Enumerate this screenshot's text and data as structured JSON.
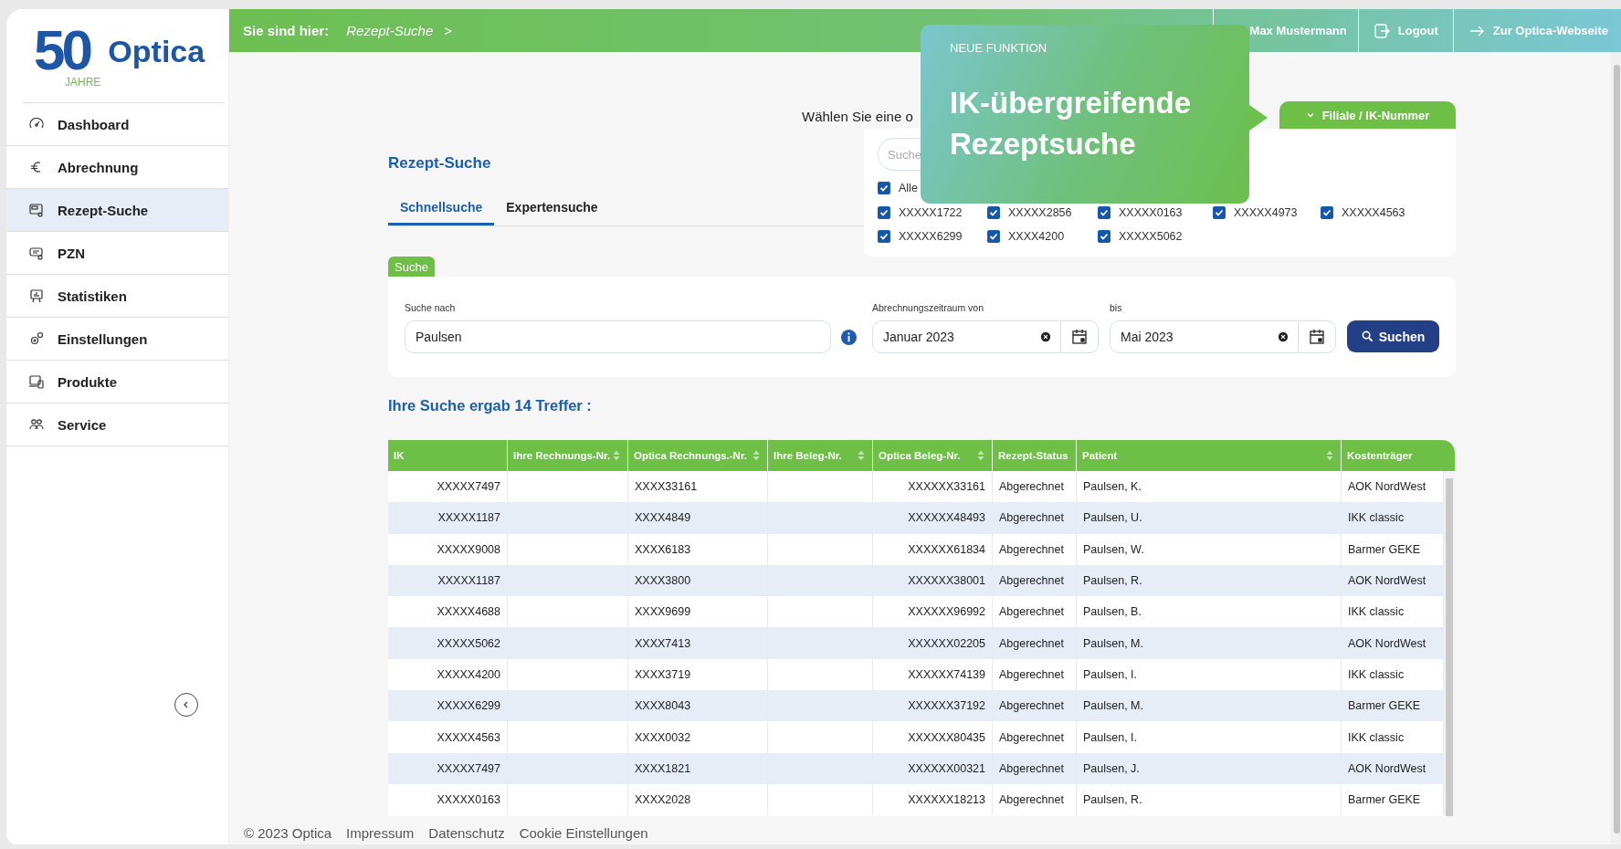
{
  "logo": {
    "number": "50",
    "jahre": "JAHRE",
    "name": "Optica"
  },
  "sidebar": {
    "items": [
      {
        "label": "Dashboard",
        "selected": false
      },
      {
        "label": "Abrechnung",
        "selected": false
      },
      {
        "label": "Rezept-Suche",
        "selected": true
      },
      {
        "label": "PZN",
        "selected": false
      },
      {
        "label": "Statistiken",
        "selected": false
      },
      {
        "label": "Einstellungen",
        "selected": false
      },
      {
        "label": "Produkte",
        "selected": false
      },
      {
        "label": "Service",
        "selected": false
      }
    ]
  },
  "topbar": {
    "breadcrumb_label": "Sie sind hier:",
    "breadcrumb": "Rezept-Suche",
    "separator": ">",
    "user": "Max Mustermann",
    "logout": "Logout",
    "website": "Zur Optica-Webseite"
  },
  "popup": {
    "eyebrow": "NEUE FUNKTION",
    "title": "IK-übergreifende Rezeptsuche"
  },
  "filter": {
    "prompt": "Wählen Sie eine o",
    "dropdown": "Filiale / IK-Nummer",
    "search_placeholder": "Suche",
    "all": {
      "label": "Alle",
      "checked": true
    },
    "items": [
      {
        "label": "XXXXX1722",
        "checked": true
      },
      {
        "label": "XXXXX2856",
        "checked": true
      },
      {
        "label": "XXXXX0163",
        "checked": true
      },
      {
        "label": "XXXXX4973",
        "checked": true
      },
      {
        "label": "XXXXX4563",
        "checked": true
      },
      {
        "label": "XXXXX6299",
        "checked": true
      },
      {
        "label": "XXXX4200",
        "checked": true
      },
      {
        "label": "XXXXX5062",
        "checked": true
      }
    ]
  },
  "page_title": "Rezept-Suche",
  "tabs": [
    {
      "label": "Schnellsuche",
      "selected": true
    },
    {
      "label": "Expertensuche",
      "selected": false
    }
  ],
  "search": {
    "tag": "Suche",
    "query_label": "Suche nach",
    "query": "Paulsen",
    "from_label": "Abrechnungszeitraum von",
    "from": "Januar 2023",
    "to_label": "bis",
    "to": "Mai 2023",
    "button": "Suchen"
  },
  "results_title": "Ihre Suche ergab 14 Treffer :",
  "table": {
    "columns": [
      {
        "label": "IK",
        "sortable": false
      },
      {
        "label": "Ihre Rechnungs-Nr.",
        "sortable": true
      },
      {
        "label": "Optica Rechnungs.-Nr.",
        "sortable": true
      },
      {
        "label": "Ihre Beleg-Nr.",
        "sortable": true
      },
      {
        "label": "Optica Beleg-Nr.",
        "sortable": true
      },
      {
        "label": "Rezept-Status",
        "sortable": false
      },
      {
        "label": "Patient",
        "sortable": true
      },
      {
        "label": "Kostenträger",
        "sortable": false
      }
    ],
    "rows": [
      {
        "ik": "XXXXX7497",
        "optica_rechnungs_nr": "XXXX33161",
        "optica_beleg_nr": "XXXXXX33161",
        "rezept_status": "Abgerechnet",
        "patient": "Paulsen, K.",
        "kostentraeger": "AOK NordWest"
      },
      {
        "ik": "XXXXX1187",
        "optica_rechnungs_nr": "XXXX4849",
        "optica_beleg_nr": "XXXXXX48493",
        "rezept_status": "Abgerechnet",
        "patient": "Paulsen, U.",
        "kostentraeger": "IKK classic"
      },
      {
        "ik": "XXXXX9008",
        "optica_rechnungs_nr": "XXXX6183",
        "optica_beleg_nr": "XXXXXX61834",
        "rezept_status": "Abgerechnet",
        "patient": "Paulsen, W.",
        "kostentraeger": "Barmer GEKE"
      },
      {
        "ik": "XXXXX1187",
        "optica_rechnungs_nr": "XXXX3800",
        "optica_beleg_nr": "XXXXXX38001",
        "rezept_status": "Abgerechnet",
        "patient": "Paulsen, R.",
        "kostentraeger": "AOK NordWest"
      },
      {
        "ik": "XXXXX4688",
        "optica_rechnungs_nr": "XXXX9699",
        "optica_beleg_nr": "XXXXXX96992",
        "rezept_status": "Abgerechnet",
        "patient": "Paulsen, B.",
        "kostentraeger": "IKK classic"
      },
      {
        "ik": "XXXXX5062",
        "optica_rechnungs_nr": "XXXX7413",
        "optica_beleg_nr": "XXXXXX02205",
        "rezept_status": "Abgerechnet",
        "patient": "Paulsen, M.",
        "kostentraeger": "AOK NordWest"
      },
      {
        "ik": "XXXXX4200",
        "optica_rechnungs_nr": "XXXX3719",
        "optica_beleg_nr": "XXXXXX74139",
        "rezept_status": "Abgerechnet",
        "patient": "Paulsen, I.",
        "kostentraeger": "IKK classic"
      },
      {
        "ik": "XXXXX6299",
        "optica_rechnungs_nr": "XXXX8043",
        "optica_beleg_nr": "XXXXXX37192",
        "rezept_status": "Abgerechnet",
        "patient": "Paulsen, M.",
        "kostentraeger": "Barmer GEKE"
      },
      {
        "ik": "XXXXX4563",
        "optica_rechnungs_nr": "XXXX0032",
        "optica_beleg_nr": "XXXXXX80435",
        "rezept_status": "Abgerechnet",
        "patient": "Paulsen, I.",
        "kostentraeger": "IKK classic"
      },
      {
        "ik": "XXXXX7497",
        "optica_rechnungs_nr": "XXXX1821",
        "optica_beleg_nr": "XXXXXX00321",
        "rezept_status": "Abgerechnet",
        "patient": "Paulsen, J.",
        "kostentraeger": "AOK NordWest"
      },
      {
        "ik": "XXXXX0163",
        "optica_rechnungs_nr": "XXXX2028",
        "optica_beleg_nr": "XXXXXX18213",
        "rezept_status": "Abgerechnet",
        "patient": "Paulsen, R.",
        "kostentraeger": "Barmer GEKE"
      }
    ]
  },
  "footer": {
    "copyright": "© 2023 Optica",
    "links": [
      "Impressum",
      "Datenschutz",
      "Cookie Einstellungen"
    ]
  }
}
